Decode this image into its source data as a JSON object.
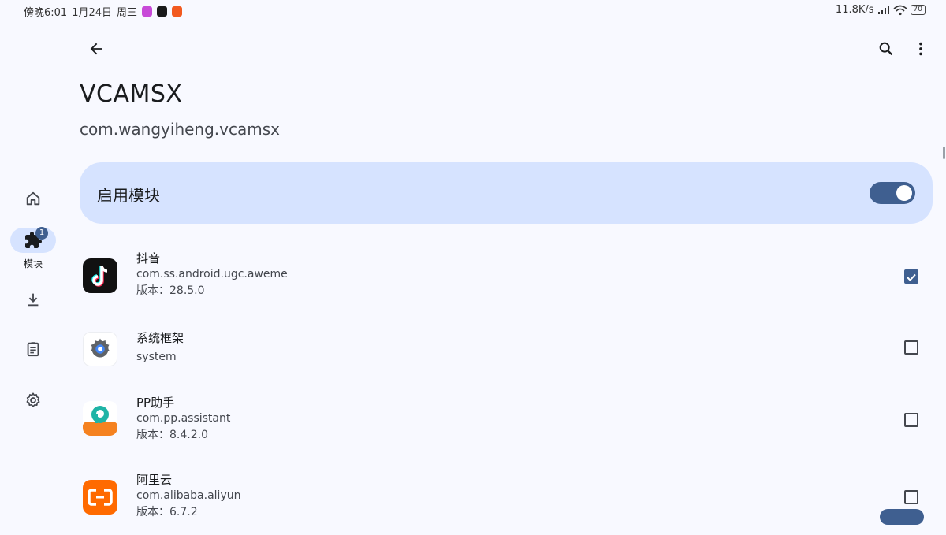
{
  "status_bar": {
    "time": "傍晚6:01",
    "date": "1月24日",
    "weekday": "周三",
    "net_speed": "11.8K/s",
    "battery": "70"
  },
  "app_bar": {
    "back_icon": "arrow-back-icon",
    "search_icon": "search-icon",
    "more_icon": "more-vert-icon"
  },
  "module": {
    "title": "VCAMSX",
    "package": "com.wangyiheng.vcamsx"
  },
  "enable_card": {
    "label": "启用模块",
    "enabled": true
  },
  "nav_rail": {
    "items": [
      {
        "icon": "home-icon",
        "label": ""
      },
      {
        "icon": "extension-icon",
        "label": "模块",
        "badge": "1",
        "active": true
      },
      {
        "icon": "download-icon",
        "label": ""
      },
      {
        "icon": "clipboard-icon",
        "label": ""
      },
      {
        "icon": "settings-icon",
        "label": ""
      }
    ]
  },
  "apps": [
    {
      "name": "抖音",
      "package": "com.ss.android.ugc.aweme",
      "version": "版本：28.5.0",
      "checked": true,
      "icon": "douyin-icon"
    },
    {
      "name": "系统框架",
      "package": "system",
      "version": "",
      "checked": false,
      "icon": "android-settings-icon"
    },
    {
      "name": "PP助手",
      "package": "com.pp.assistant",
      "version": "版本：8.4.2.0",
      "checked": false,
      "icon": "pp-assistant-icon"
    },
    {
      "name": "阿里云",
      "package": "com.alibaba.aliyun",
      "version": "版本：6.7.2",
      "checked": false,
      "icon": "aliyun-icon"
    }
  ],
  "colors": {
    "accent": "#3f5f90",
    "card": "#d6e3ff",
    "background": "#f8f9ff"
  }
}
